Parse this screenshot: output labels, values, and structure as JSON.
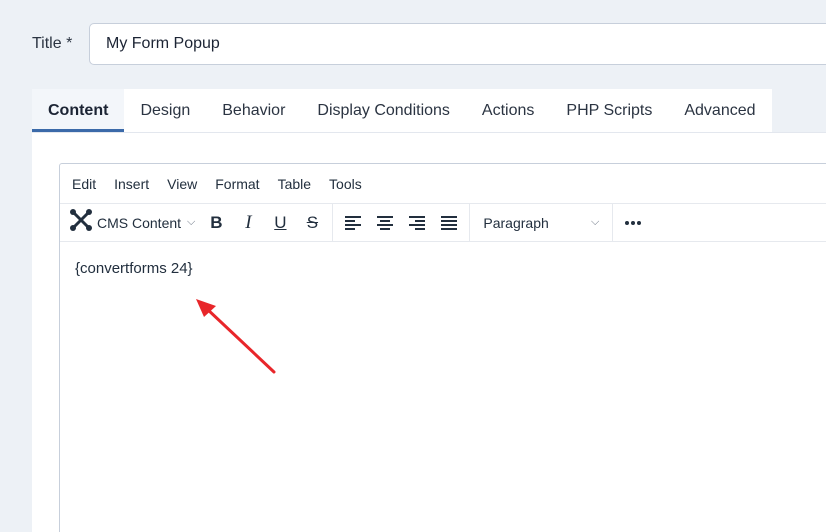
{
  "form": {
    "title_label": "Title *",
    "title_value": "My Form Popup"
  },
  "tabs": [
    {
      "label": "Content",
      "active": true
    },
    {
      "label": "Design"
    },
    {
      "label": "Behavior"
    },
    {
      "label": "Display Conditions"
    },
    {
      "label": "Actions"
    },
    {
      "label": "PHP Scripts"
    },
    {
      "label": "Advanced"
    }
  ],
  "editor": {
    "menu": [
      "Edit",
      "Insert",
      "View",
      "Format",
      "Table",
      "Tools"
    ],
    "toolbar": {
      "cms_content_label": "CMS Content",
      "block_format_value": "Paragraph",
      "icons": [
        "joomla-icon",
        "bold-icon",
        "italic-icon",
        "underline-icon",
        "strikethrough-icon",
        "align-left-icon",
        "align-center-icon",
        "align-right-icon",
        "align-justify-icon",
        "more-icon"
      ]
    },
    "body_text": "{convertforms 24}"
  },
  "colors": {
    "accent": "#3b6aa9",
    "annotation_arrow": "#e8262a"
  }
}
